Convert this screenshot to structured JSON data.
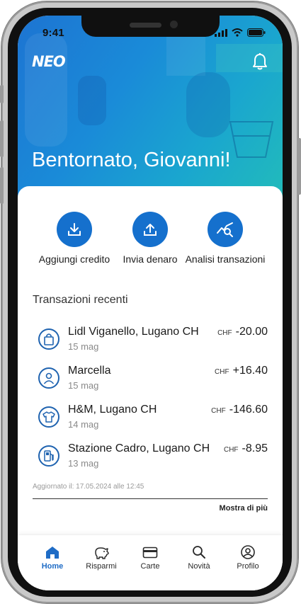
{
  "status": {
    "time": "9:41"
  },
  "header": {
    "logo": "NEO",
    "greeting": "Bentornato, Giovanni!",
    "bell_icon": "bell-icon"
  },
  "actions": [
    {
      "label": "Aggiungi credito",
      "icon": "download-icon"
    },
    {
      "label": "Invia denaro",
      "icon": "upload-icon"
    },
    {
      "label": "Analisi transazioni",
      "icon": "chart-search-icon"
    }
  ],
  "transactions": {
    "title": "Transazioni recenti",
    "items": [
      {
        "name": "Lidl Viganello, Lugano CH",
        "date": "15 mag",
        "currency": "CHF",
        "amount": "-20.00",
        "icon": "shopping-bag-icon"
      },
      {
        "name": "Marcella",
        "date": "15 mag",
        "currency": "CHF",
        "amount": "+16.40",
        "icon": "person-icon"
      },
      {
        "name": "H&M, Lugano CH",
        "date": "14 mag",
        "currency": "CHF",
        "amount": "-146.60",
        "icon": "tshirt-icon"
      },
      {
        "name": "Stazione Cadro, Lugano CH",
        "date": "13 mag",
        "currency": "CHF",
        "amount": "-8.95",
        "icon": "fuel-pump-icon"
      }
    ],
    "updated": "Aggiornato il: 17.05.2024 alle 12:45",
    "more": "Mostra di più"
  },
  "tabs": [
    {
      "label": "Home",
      "icon": "home-icon",
      "active": true
    },
    {
      "label": "Risparmi",
      "icon": "piggy-bank-icon",
      "active": false
    },
    {
      "label": "Carte",
      "icon": "card-icon",
      "active": false
    },
    {
      "label": "Novità",
      "icon": "search-icon",
      "active": false
    },
    {
      "label": "Profilo",
      "icon": "profile-icon",
      "active": false
    }
  ],
  "colors": {
    "accent": "#1570cd",
    "hero_start": "#1d74d2",
    "hero_end": "#22bdb9",
    "active_tab": "#1f6cc6"
  }
}
